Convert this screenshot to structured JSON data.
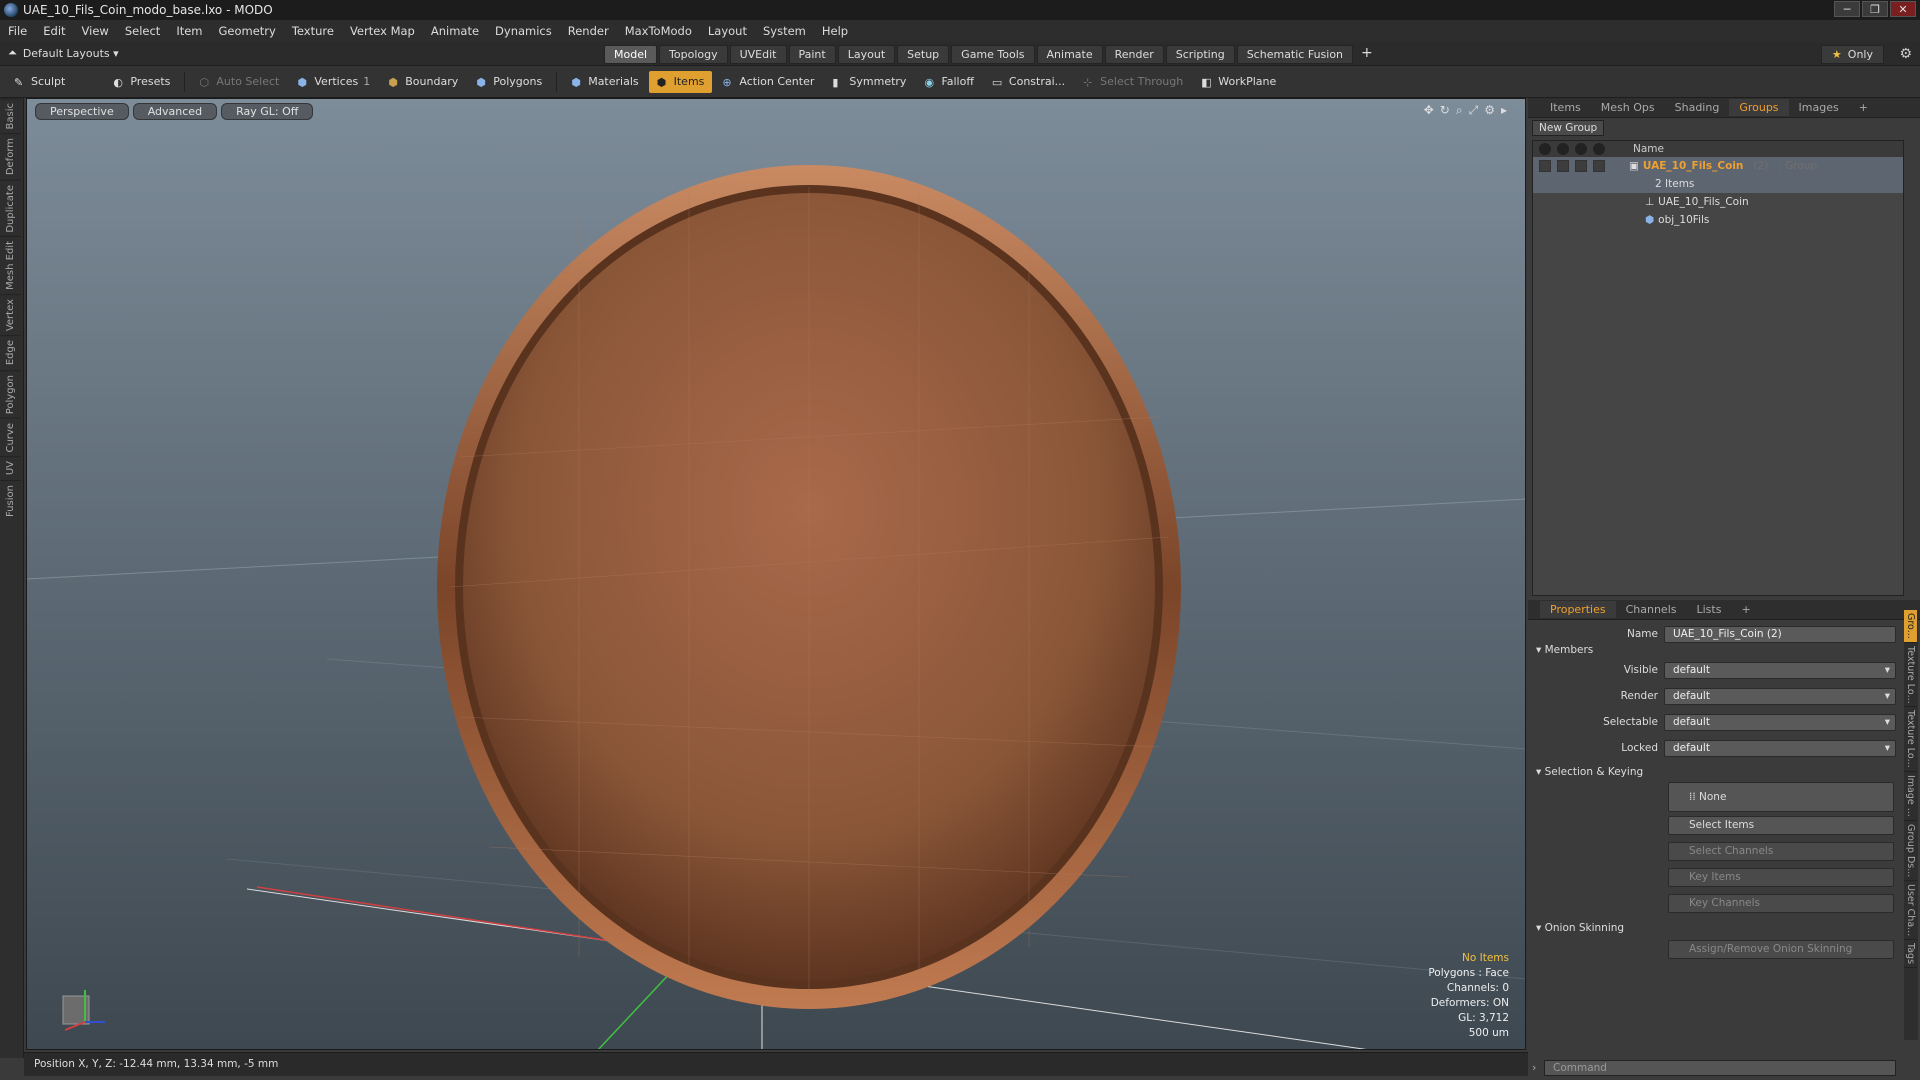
{
  "window": {
    "title": "UAE_10_Fils_Coin_modo_base.lxo - MODO",
    "min": "─",
    "max": "❐",
    "close": "✕"
  },
  "menu": [
    "File",
    "Edit",
    "View",
    "Select",
    "Item",
    "Geometry",
    "Texture",
    "Vertex Map",
    "Animate",
    "Dynamics",
    "Render",
    "MaxToModo",
    "Layout",
    "System",
    "Help"
  ],
  "layout": {
    "default_layouts": "Default Layouts ▾",
    "tabs": [
      "Model",
      "Topology",
      "UVEdit",
      "Paint",
      "Layout",
      "Setup",
      "Game Tools",
      "Animate",
      "Render",
      "Scripting",
      "Schematic Fusion"
    ],
    "active_tab": "Model",
    "plus": "+",
    "only": "Only",
    "only_star": "★"
  },
  "toolbar": {
    "sculpt": "Sculpt",
    "presets": "Presets",
    "auto_select": "Auto Select",
    "vertices": "Vertices",
    "vertices_count": "1",
    "boundary": "Boundary",
    "polygons": "Polygons",
    "materials": "Materials",
    "items": "Items",
    "action_center": "Action Center",
    "symmetry": "Symmetry",
    "falloff": "Falloff",
    "constraints": "Constrai...",
    "select_through": "Select Through",
    "workplane": "WorkPlane"
  },
  "left_strip": [
    "Basic",
    "Deform",
    "Duplicate",
    "Mesh Edit",
    "Vertex",
    "Edge",
    "Polygon",
    "Curve",
    "UV",
    "Fusion"
  ],
  "viewport": {
    "view": "Perspective",
    "mode": "Advanced",
    "raygl": "Ray GL: Off",
    "info": {
      "items": "No Items",
      "polygons": "Polygons : Face",
      "channels": "Channels: 0",
      "deformers": "Deformers: ON",
      "gl": "GL: 3,712",
      "scale": "500 um"
    }
  },
  "status": "Position X, Y, Z:  -12.44 mm, 13.34 mm, -5 mm",
  "groups_panel": {
    "tabs": [
      "Items",
      "Mesh Ops",
      "Shading",
      "Groups",
      "Images",
      "+"
    ],
    "active_tab": "Groups",
    "new_group": "New Group",
    "name_col": "Name",
    "group_name": "UAE_10_Fils_Coin",
    "group_count": "(2)",
    "group_type": ": Group",
    "items_count": "2 Items",
    "children": [
      "UAE_10_Fils_Coin",
      "obj_10Fils"
    ]
  },
  "props_panel": {
    "tabs": [
      "Properties",
      "Channels",
      "Lists",
      "+"
    ],
    "active_tab": "Properties",
    "name_label": "Name",
    "name_value": "UAE_10_Fils_Coin (2)",
    "members": "Members",
    "fields": [
      {
        "label": "Visible",
        "value": "default"
      },
      {
        "label": "Render",
        "value": "default"
      },
      {
        "label": "Selectable",
        "value": "default"
      },
      {
        "label": "Locked",
        "value": "default"
      }
    ],
    "selection_keying": "Selection & Keying",
    "none": "None",
    "select_items": "Select Items",
    "select_channels": "Select Channels",
    "key_items": "Key Items",
    "key_channels": "Key Channels",
    "onion": "Onion Skinning",
    "onion_btn": "Assign/Remove Onion Skinning",
    "command_placeholder": "Command",
    "side_tabs": [
      "Gro...",
      "Texture Lo...",
      "Texture Lo...",
      "Image ...",
      "Group Ds...",
      "User Cha...",
      "Tags"
    ]
  },
  "colors": {
    "accent": "#e0a030",
    "copper": "#9a6140",
    "sky_top": "#7d8c99"
  }
}
